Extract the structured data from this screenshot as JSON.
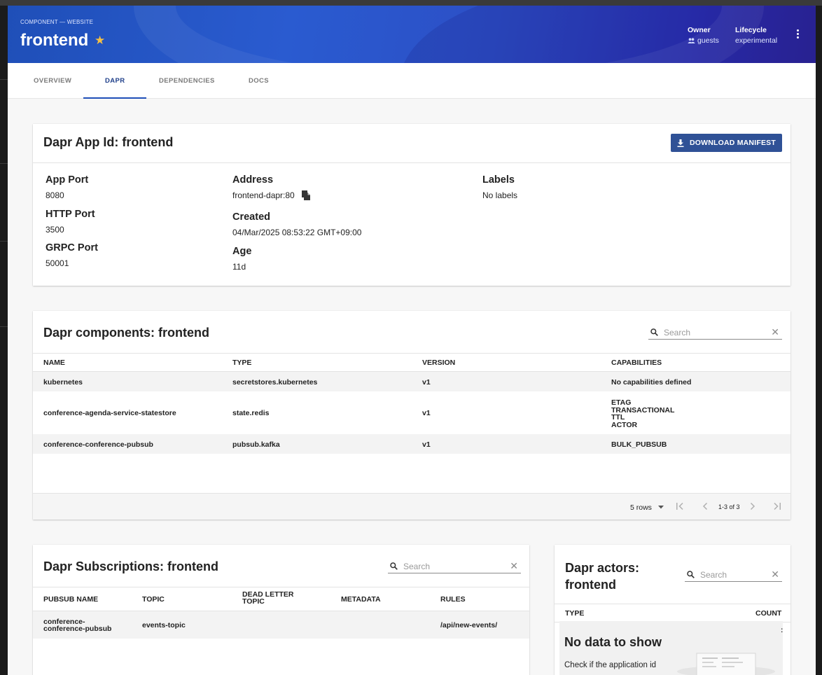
{
  "header": {
    "breadcrumb": "COMPONENT — WEBSITE",
    "title": "frontend",
    "owner_label": "Owner",
    "owner_value": "guests",
    "lifecycle_label": "Lifecycle",
    "lifecycle_value": "experimental"
  },
  "tabs": [
    "OVERVIEW",
    "DAPR",
    "DEPENDENCIES",
    "DOCS"
  ],
  "app_card": {
    "title": "Dapr App Id: frontend",
    "download_label": "DOWNLOAD MANIFEST",
    "app_port_label": "App Port",
    "app_port": "8080",
    "http_port_label": "HTTP Port",
    "http_port": "3500",
    "grpc_port_label": "GRPC Port",
    "grpc_port": "50001",
    "address_label": "Address",
    "address": "frontend-dapr:80",
    "created_label": "Created",
    "created": "04/Mar/2025 08:53:22 GMT+09:00",
    "age_label": "Age",
    "age": "11d",
    "labels_label": "Labels",
    "labels": "No labels"
  },
  "components": {
    "title": "Dapr components: frontend",
    "search_placeholder": "Search",
    "headers": [
      "NAME",
      "TYPE",
      "VERSION",
      "CAPABILITIES"
    ],
    "rows": [
      {
        "name": "kubernetes",
        "type": "secretstores.kubernetes",
        "version": "v1",
        "capabilities": [
          "No capabilities defined"
        ]
      },
      {
        "name": "conference-agenda-service-statestore",
        "type": "state.redis",
        "version": "v1",
        "capabilities": [
          "ETAG",
          "TRANSACTIONAL",
          "TTL",
          "ACTOR"
        ]
      },
      {
        "name": "conference-conference-pubsub",
        "type": "pubsub.kafka",
        "version": "v1",
        "capabilities": [
          "BULK_PUBSUB"
        ]
      }
    ],
    "rows_per_page": "5 rows",
    "range": "1-3 of 3"
  },
  "subscriptions": {
    "title": "Dapr Subscriptions: frontend",
    "search_placeholder": "Search",
    "headers": [
      "PUBSUB NAME",
      "TOPIC",
      "DEAD LETTER TOPIC",
      "METADATA",
      "RULES"
    ],
    "rows": [
      {
        "pubsub": [
          "conference-",
          "conference-pubsub"
        ],
        "topic": "events-topic",
        "dead_letter": "",
        "metadata": "",
        "rules": "/api/new-events/"
      }
    ]
  },
  "actors": {
    "title_line1": "Dapr actors:",
    "title_line2": "frontend",
    "search_placeholder": "Search",
    "headers": [
      "TYPE",
      "COUNT"
    ],
    "empty_title": "No data to show",
    "empty_text": "Check if the application id"
  }
}
